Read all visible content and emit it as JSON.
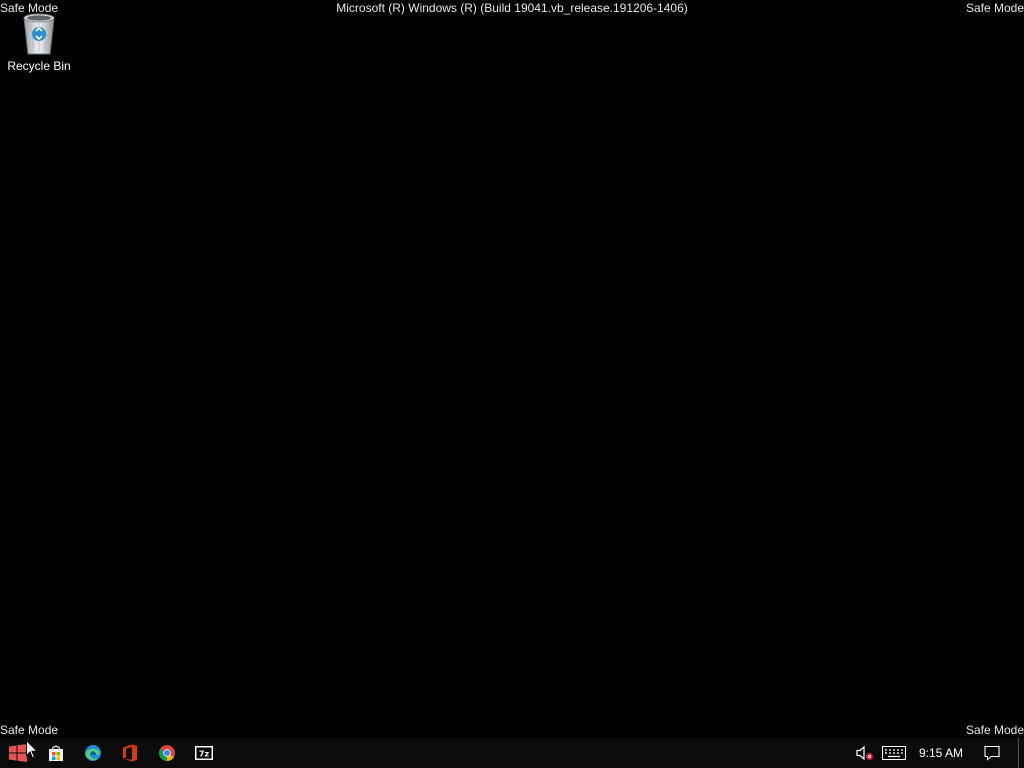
{
  "desktop": {
    "safe_mode_label": "Safe Mode",
    "build_string": "Microsoft (R) Windows (R) (Build 19041.vb_release.191206-1406)",
    "background_color": "#000000",
    "icons": [
      {
        "label": "Recycle Bin",
        "icon": "recycle-bin-icon"
      }
    ]
  },
  "taskbar": {
    "pinned": [
      {
        "name": "start",
        "icon": "windows-logo-icon",
        "color": "#e8524f"
      },
      {
        "name": "microsoft-store",
        "icon": "store-bag-icon"
      },
      {
        "name": "microsoft-edge",
        "icon": "edge-icon"
      },
      {
        "name": "office",
        "icon": "office-icon",
        "color": "#d83b01"
      },
      {
        "name": "google-chrome",
        "icon": "chrome-icon"
      },
      {
        "name": "7-zip",
        "icon": "7zip-icon"
      }
    ],
    "tray": {
      "volume": {
        "icon": "volume-muted-icon",
        "muted": true
      },
      "keyboard": {
        "icon": "keyboard-icon"
      },
      "clock": "9:15 AM",
      "notifications": {
        "icon": "action-center-icon"
      }
    }
  }
}
